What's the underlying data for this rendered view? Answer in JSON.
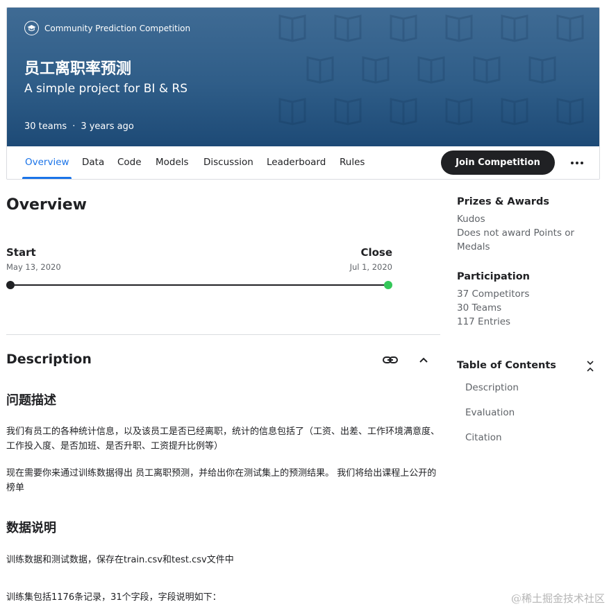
{
  "banner": {
    "label": "Community Prediction Competition",
    "title": "员工离职率预测",
    "subtitle": "A simple project for BI & RS",
    "teams": "30 teams",
    "separator": "·",
    "age": "3 years ago",
    "bg_color": "#2f5d88"
  },
  "tabs": [
    {
      "label": "Overview",
      "active": true
    },
    {
      "label": "Data"
    },
    {
      "label": "Code"
    },
    {
      "label": "Models"
    },
    {
      "label": "Discussion"
    },
    {
      "label": "Leaderboard"
    },
    {
      "label": "Rules"
    }
  ],
  "actions": {
    "join_label": "Join Competition",
    "more_icon": "more-horizontal-icon"
  },
  "overview": {
    "title": "Overview",
    "start_label": "Start",
    "start_date": "May 13, 2020",
    "close_label": "Close",
    "close_date": "Jul 1, 2020",
    "end_dot_color": "#34c759"
  },
  "description": {
    "title": "Description",
    "h_problem": "问题描述",
    "p1": "我们有员工的各种统计信息，以及该员工是否已经离职，统计的信息包括了（工资、出差、工作环境满意度、工作投入度、是否加班、是否升职、工资提升比例等）",
    "p2": "现在需要你来通过训练数据得出 员工离职预测，并给出你在测试集上的预测结果。 我们将给出课程上公开的榜单",
    "h_data": "数据说明",
    "p3": "训练数据和测试数据，保存在train.csv和test.csv文件中",
    "p4": "训练集包括1176条记录，31个字段，字段说明如下："
  },
  "sidebar": {
    "prizes_title": "Prizes & Awards",
    "prizes_l1": "Kudos",
    "prizes_l2": "Does not award Points or Medals",
    "participation_title": "Participation",
    "competitors": "37 Competitors",
    "teams": "30 Teams",
    "entries": "117 Entries",
    "toc_title": "Table of Contents",
    "toc": [
      "Description",
      "Evaluation",
      "Citation"
    ]
  },
  "watermark": "@稀土掘金技术社区"
}
